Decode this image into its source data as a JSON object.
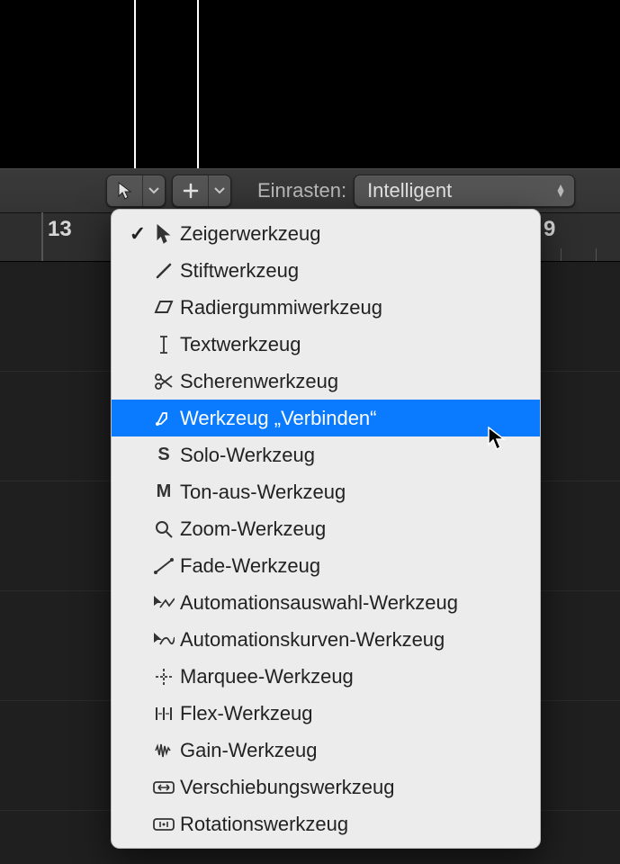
{
  "toolbar": {
    "snap_label": "Einrasten:",
    "snap_value": "Intelligent"
  },
  "ruler": {
    "numbers": [
      "13"
    ],
    "right_edge_glyph": "9"
  },
  "dropdown": {
    "items": [
      {
        "id": "pointer",
        "label": "Zeigerwerkzeug",
        "checked": true,
        "selected": false
      },
      {
        "id": "pencil",
        "label": "Stiftwerkzeug",
        "checked": false,
        "selected": false
      },
      {
        "id": "eraser",
        "label": "Radiergummiwerkzeug",
        "checked": false,
        "selected": false
      },
      {
        "id": "text",
        "label": "Textwerkzeug",
        "checked": false,
        "selected": false
      },
      {
        "id": "scissors",
        "label": "Scherenwerkzeug",
        "checked": false,
        "selected": false
      },
      {
        "id": "glue",
        "label": "Werkzeug „Verbinden“",
        "checked": false,
        "selected": true
      },
      {
        "id": "solo",
        "label": "Solo-Werkzeug",
        "checked": false,
        "selected": false,
        "glyph": "S"
      },
      {
        "id": "mute",
        "label": "Ton-aus-Werkzeug",
        "checked": false,
        "selected": false,
        "glyph": "M"
      },
      {
        "id": "zoom",
        "label": "Zoom-Werkzeug",
        "checked": false,
        "selected": false
      },
      {
        "id": "fade",
        "label": "Fade-Werkzeug",
        "checked": false,
        "selected": false
      },
      {
        "id": "autosel",
        "label": "Automationsauswahl-Werkzeug",
        "checked": false,
        "selected": false
      },
      {
        "id": "autocurve",
        "label": "Automationskurven-Werkzeug",
        "checked": false,
        "selected": false
      },
      {
        "id": "marquee",
        "label": "Marquee-Werkzeug",
        "checked": false,
        "selected": false
      },
      {
        "id": "flex",
        "label": "Flex-Werkzeug",
        "checked": false,
        "selected": false
      },
      {
        "id": "gain",
        "label": "Gain-Werkzeug",
        "checked": false,
        "selected": false
      },
      {
        "id": "move",
        "label": "Verschiebungswerkzeug",
        "checked": false,
        "selected": false
      },
      {
        "id": "rotate",
        "label": "Rotationswerkzeug",
        "checked": false,
        "selected": false
      }
    ]
  }
}
